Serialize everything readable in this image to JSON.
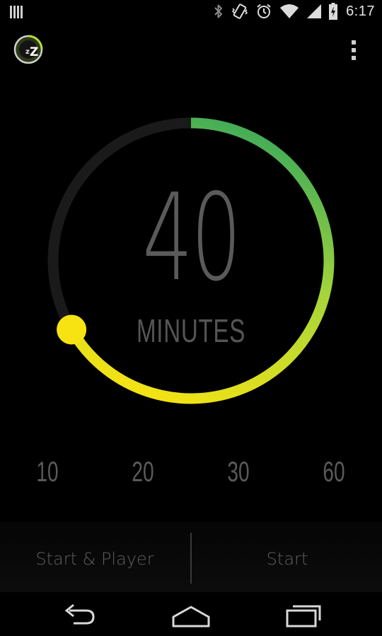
{
  "status_bar": {
    "time": "6:17",
    "icons": [
      "notification-bars-icon",
      "bluetooth-icon",
      "vibrate-icon",
      "alarm-icon",
      "wifi-icon",
      "cell-signal-icon",
      "battery-charging-icon"
    ]
  },
  "app_bar": {
    "logo_icon": "sleep-timer-logo-icon",
    "menu_icon": "overflow-menu-icon"
  },
  "dial": {
    "value": "40",
    "unit": "MINUTES",
    "progress_fraction": 0.6667,
    "colors": {
      "track": "#1a1a1a",
      "arc_start": "#3aa95a",
      "arc_mid": "#a6d63a",
      "arc_end": "#f7e312",
      "knob": "#f7e312"
    }
  },
  "presets": [
    "10",
    "20",
    "30",
    "60"
  ],
  "actions": {
    "start_player": "Start & Player",
    "start": "Start"
  },
  "nav": {
    "back_icon": "back-icon",
    "home_icon": "home-icon",
    "recents_icon": "recents-icon"
  }
}
